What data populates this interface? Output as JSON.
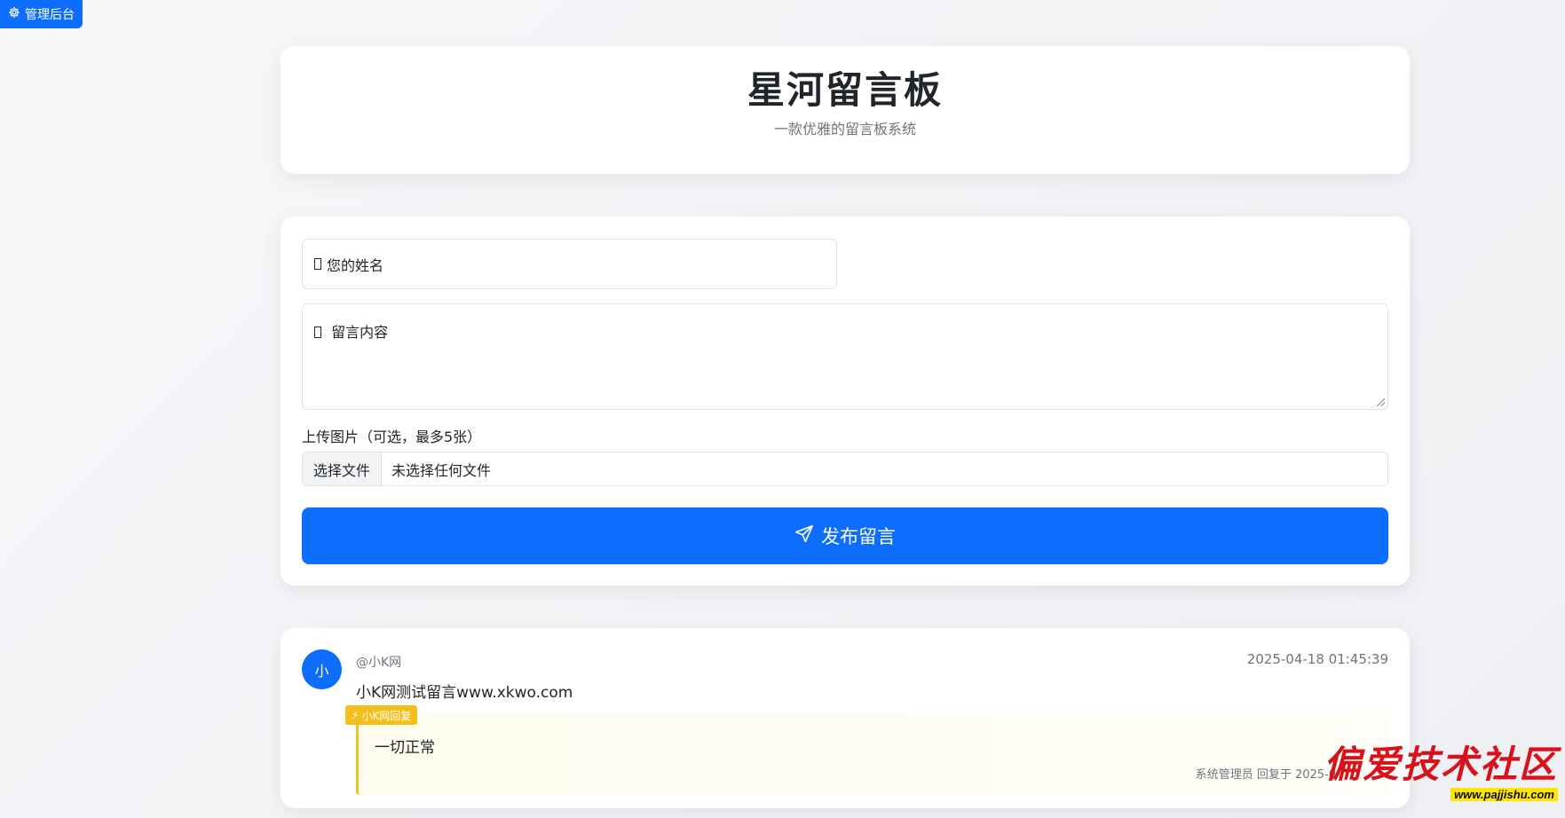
{
  "admin": {
    "label": "管理后台",
    "icon": "gear-icon"
  },
  "header": {
    "title": "星河留言板",
    "subtitle": "一款优雅的留言板系统"
  },
  "form": {
    "name_placeholder": "您的姓名",
    "content_placeholder": "留言内容",
    "upload_label": "上传图片（可选，最多5张）",
    "file_button": "选择文件",
    "file_status": "未选择任何文件",
    "submit_label": "发布留言",
    "submit_icon": "send-icon"
  },
  "messages": [
    {
      "avatar": "小",
      "user": "@小K网",
      "time": "2025-04-18 01:45:39",
      "text": "小K网测试留言www.xkwo.com",
      "reply": {
        "badge": "小K网回复",
        "text": "一切正常",
        "meta": "系统管理员 回复于 2025-0"
      }
    }
  ],
  "watermark": {
    "text": "偏爱技术社区",
    "url": "www.pajjishu.com"
  },
  "colors": {
    "primary": "#0d6efd",
    "reply_accent": "#f0c11d",
    "watermark_red": "#d8111b"
  }
}
